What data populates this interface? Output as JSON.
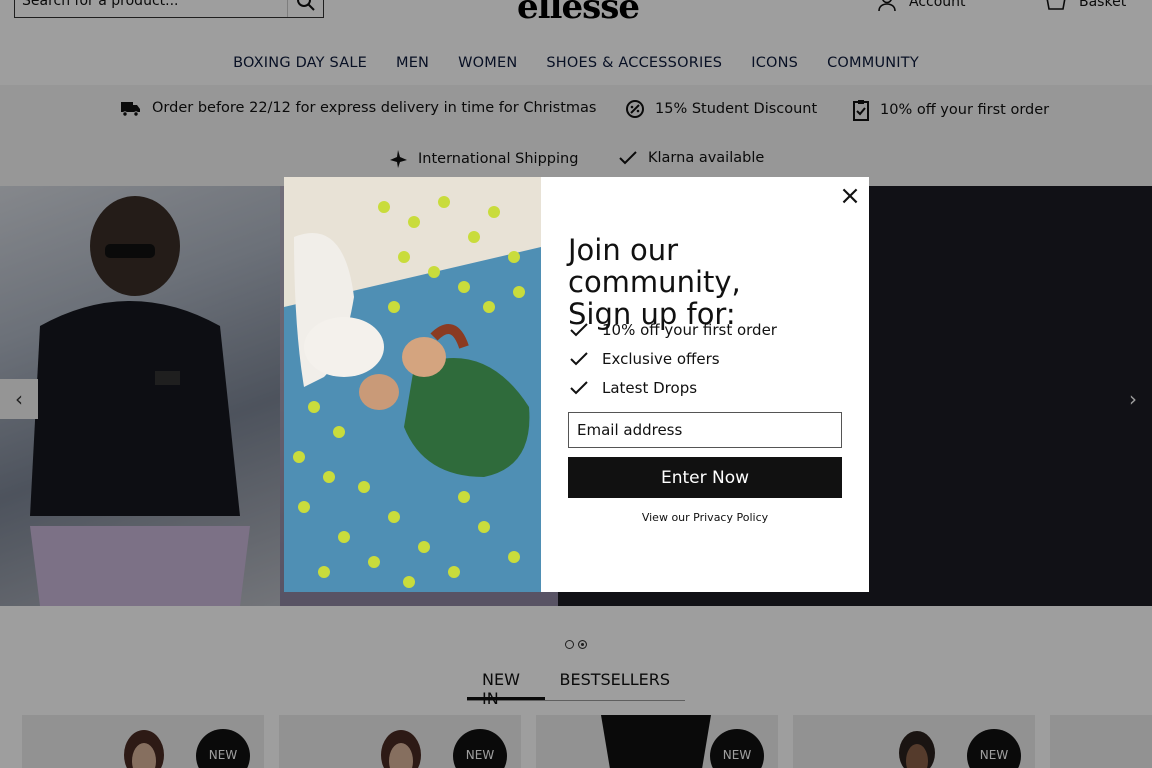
{
  "header": {
    "search_placeholder": "Search for a product...",
    "logo": "ellesse",
    "account_label": "Account",
    "basket_label": "Basket"
  },
  "nav": [
    "BOXING DAY SALE",
    "MEN",
    "WOMEN",
    "SHOES & ACCESSORIES",
    "ICONS",
    "COMMUNITY"
  ],
  "usp": {
    "delivery": "Order before 22/12 for express delivery in time for Christmas",
    "student": "15% Student Discount",
    "first_order": "10% off your first order",
    "shipping": "International Shipping",
    "klarna": "Klarna available"
  },
  "carousel": {
    "prev": "‹",
    "next": "›",
    "slides": 2,
    "active_slide": 2
  },
  "modal": {
    "close": "×",
    "title_line1": "Join our community,",
    "title_line2": "Sign up for:",
    "benefits": [
      "10% off your first order",
      "Exclusive offers",
      "Latest Drops"
    ],
    "email_placeholder": "Email address",
    "submit": "Enter Now",
    "privacy": "View our Privacy Policy"
  },
  "tabs": [
    {
      "label": "NEW IN",
      "active": true
    },
    {
      "label": "BESTSELLERS",
      "active": false
    }
  ],
  "products": [
    {
      "badge": "NEW"
    },
    {
      "badge": "NEW"
    },
    {
      "badge": "NEW"
    },
    {
      "badge": "NEW"
    }
  ],
  "colors": {
    "nav_text": "#0d1a3b",
    "button": "#111111",
    "usp_bg": "#f4f4f4"
  }
}
